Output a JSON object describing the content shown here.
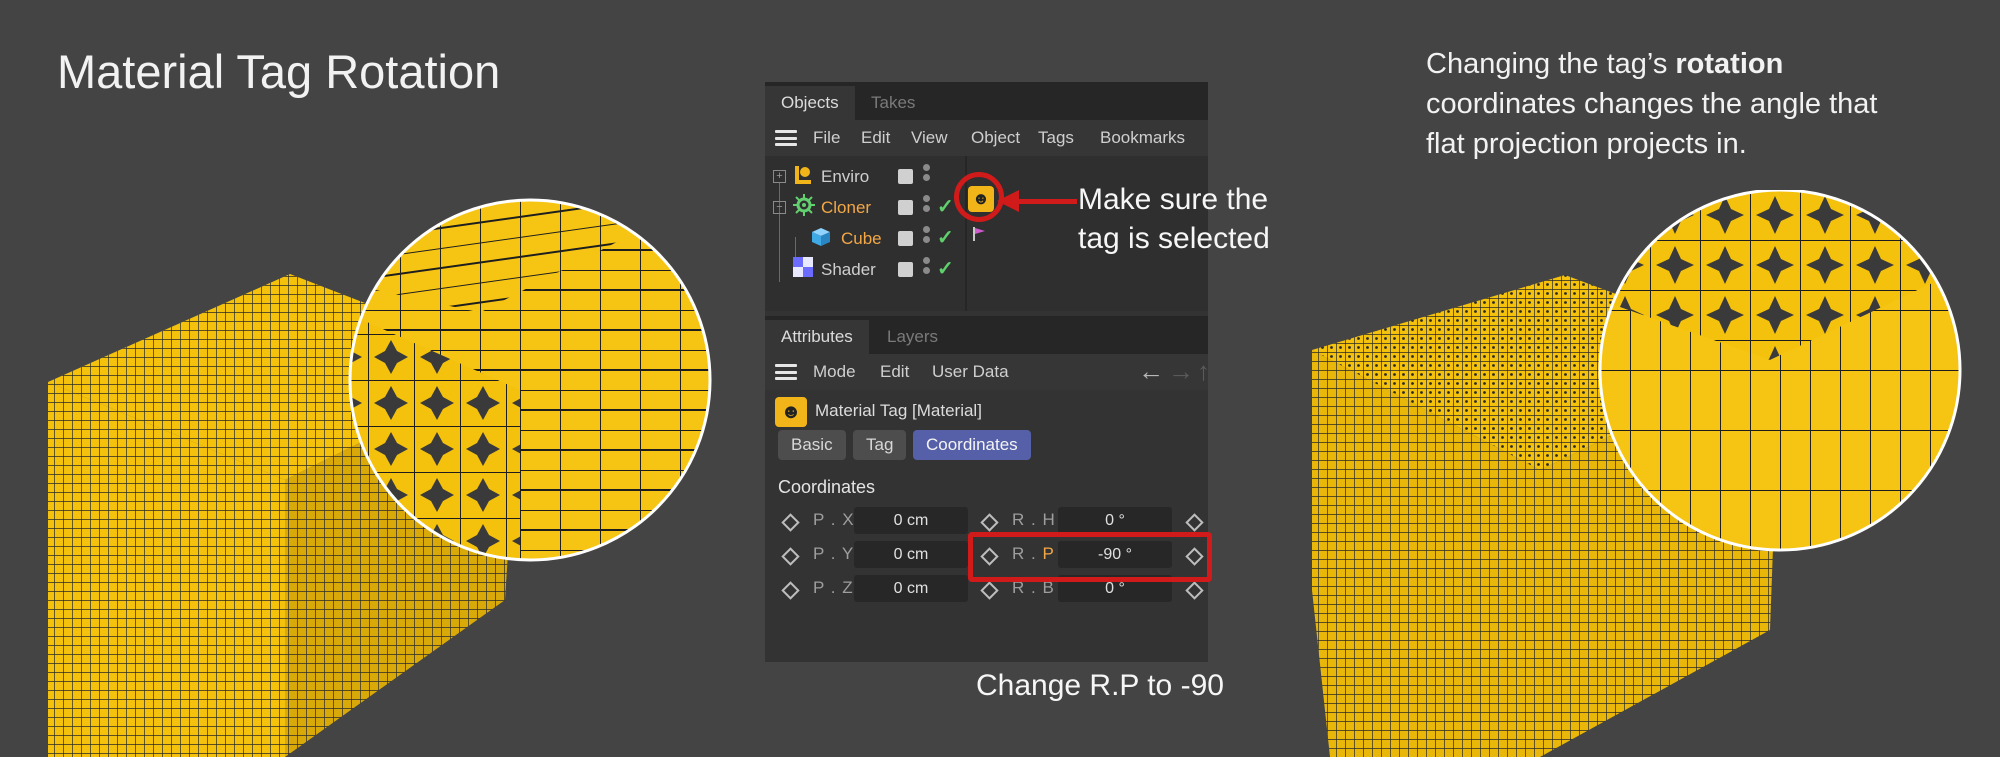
{
  "title": "Material Tag Rotation",
  "description": {
    "line1_prefix": "Changing the tag’s ",
    "line1_bold": "rotation",
    "line2": "coordinates changes the angle that",
    "line3": "flat projection projects in."
  },
  "callouts": {
    "tag_line1": "Make sure the",
    "tag_line2": "tag is selected",
    "rp": "Change R.P to -90"
  },
  "objects_panel": {
    "tabs": [
      "Objects",
      "Takes"
    ],
    "menu": [
      "File",
      "Edit",
      "View",
      "Object",
      "Tags",
      "Bookmarks"
    ],
    "rows": [
      {
        "name": "Enviro",
        "icon": "light-icon"
      },
      {
        "name": "Cloner",
        "icon": "cloner-icon"
      },
      {
        "name": "Cube",
        "icon": "cube-icon"
      },
      {
        "name": "Shader",
        "icon": "shader-icon"
      }
    ]
  },
  "attributes_panel": {
    "tabs": [
      "Attributes",
      "Layers"
    ],
    "menu": [
      "Mode",
      "Edit",
      "User Data"
    ],
    "material_name": "Material Tag [Material]",
    "subtabs": [
      "Basic",
      "Tag",
      "Coordinates"
    ],
    "section": "Coordinates",
    "coords": {
      "px": {
        "label": "P . X",
        "value": "0 cm"
      },
      "py": {
        "label": "P . Y",
        "value": "0 cm"
      },
      "pz": {
        "label": "P . Z",
        "value": "0 cm"
      },
      "rh": {
        "label": "R . H",
        "value": "0 °"
      },
      "rp_prefix": "R . ",
      "rp_suffix": "P",
      "rp_value": "-90 °",
      "rb": {
        "label": "R . B",
        "value": "0 °"
      }
    }
  },
  "colors": {
    "accent_red": "#d11b1b",
    "cube_yellow": "#f4c20d",
    "active_tab": "#5560a8"
  }
}
